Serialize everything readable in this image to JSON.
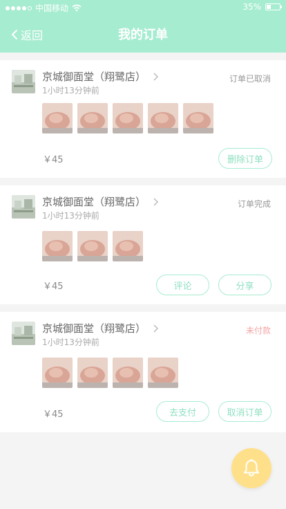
{
  "status_bar": {
    "carrier": "中国移动",
    "battery": "35%",
    "battery_level": 0.35,
    "wifi_icon": "wifi-icon"
  },
  "nav": {
    "back_label": "返回",
    "title": "我的订单"
  },
  "orders": [
    {
      "shop_name": "京城御面堂（翔鹭店）",
      "time": "1小时13分钟前",
      "status": "订单已取消",
      "price": "￥45",
      "thumb_count": 5,
      "buttons": [
        "删除订单"
      ]
    },
    {
      "shop_name": "京城御面堂（翔鹭店）",
      "time": "1小时13分钟前",
      "status": "订单完成",
      "price": "￥45",
      "thumb_count": 3,
      "buttons": [
        "评论",
        "分享"
      ]
    },
    {
      "shop_name": "京城御面堂（翔鹭店）",
      "time": "1小时13分钟前",
      "status": "未付款",
      "price": "￥45",
      "thumb_count": 4,
      "buttons": [
        "去支付",
        "取消订单"
      ]
    }
  ],
  "colors": {
    "accent": "#a6ecd0",
    "unpaid": "#f3a5a5",
    "fab": "#ffe08a"
  },
  "fab_icon": "bell-icon"
}
